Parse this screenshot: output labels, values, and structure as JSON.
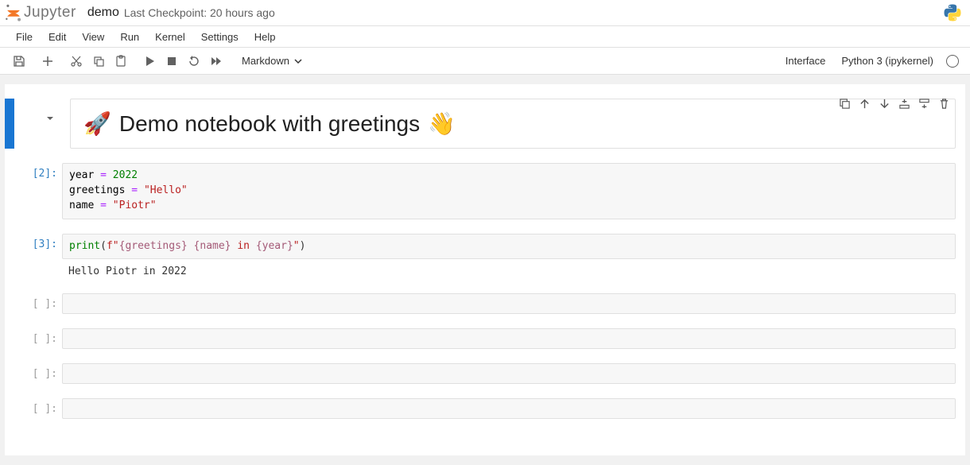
{
  "header": {
    "logo_text": "Jupyter",
    "notebook_name": "demo",
    "checkpoint": "Last Checkpoint: 20 hours ago"
  },
  "menubar": {
    "items": [
      "File",
      "Edit",
      "View",
      "Run",
      "Kernel",
      "Settings",
      "Help"
    ]
  },
  "toolbar": {
    "cell_type": "Markdown",
    "right_interface": "Interface",
    "right_kernel": "Python 3 (ipykernel)"
  },
  "cells": [
    {
      "type": "markdown",
      "selected": true,
      "heading_emoji_left": "🚀",
      "heading_text": "Demo notebook with greetings",
      "heading_emoji_right": "👋"
    },
    {
      "type": "code",
      "prompt": "[2]:",
      "tokens": [
        {
          "t": "year",
          "c": "tok-name"
        },
        {
          "t": " "
        },
        {
          "t": "=",
          "c": "tok-op"
        },
        {
          "t": " "
        },
        {
          "t": "2022",
          "c": "tok-num"
        },
        {
          "t": "\n"
        },
        {
          "t": "greetings",
          "c": "tok-name"
        },
        {
          "t": " "
        },
        {
          "t": "=",
          "c": "tok-op"
        },
        {
          "t": " "
        },
        {
          "t": "\"Hello\"",
          "c": "tok-str"
        },
        {
          "t": "\n"
        },
        {
          "t": "name",
          "c": "tok-name"
        },
        {
          "t": " "
        },
        {
          "t": "=",
          "c": "tok-op"
        },
        {
          "t": " "
        },
        {
          "t": "\"Piotr\"",
          "c": "tok-str"
        }
      ]
    },
    {
      "type": "code",
      "prompt": "[3]:",
      "tokens": [
        {
          "t": "print",
          "c": "tok-builtin"
        },
        {
          "t": "("
        },
        {
          "t": "f\"",
          "c": "tok-fstr"
        },
        {
          "t": "{greetings}",
          "c": "tok-strinterp"
        },
        {
          "t": " ",
          "c": "tok-fstr"
        },
        {
          "t": "{name}",
          "c": "tok-strinterp"
        },
        {
          "t": " ",
          "c": "tok-fstr"
        },
        {
          "t": "in",
          "c": "tok-fstr"
        },
        {
          "t": " ",
          "c": "tok-fstr"
        },
        {
          "t": "{year}",
          "c": "tok-strinterp"
        },
        {
          "t": "\"",
          "c": "tok-fstr"
        },
        {
          "t": ")"
        }
      ],
      "output": "Hello Piotr in 2022"
    },
    {
      "type": "code",
      "prompt": "[ ]:",
      "empty": true
    },
    {
      "type": "code",
      "prompt": "[ ]:",
      "empty": true
    },
    {
      "type": "code",
      "prompt": "[ ]:",
      "empty": true
    },
    {
      "type": "code",
      "prompt": "[ ]:",
      "empty": true
    }
  ]
}
